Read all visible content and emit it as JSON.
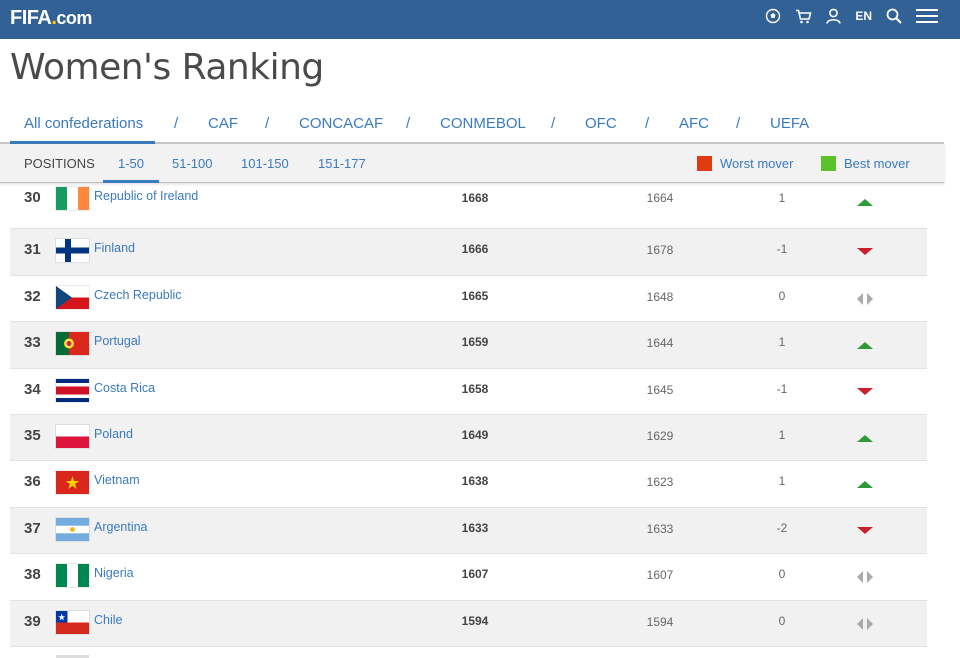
{
  "header": {
    "logo_main": "FIFA",
    "logo_suffix": "com",
    "language": "EN",
    "icons": [
      "ball-icon",
      "cart-icon",
      "user-icon",
      "search-icon",
      "menu-icon"
    ]
  },
  "page_title": "Women's Ranking",
  "confederations": [
    {
      "label": "All confederations",
      "active": true
    },
    {
      "label": "CAF"
    },
    {
      "label": "CONCACAF"
    },
    {
      "label": "CONMEBOL"
    },
    {
      "label": "OFC"
    },
    {
      "label": "AFC"
    },
    {
      "label": "UEFA"
    }
  ],
  "separator": "/",
  "position_tabs": {
    "label": "POSITIONS",
    "tabs": [
      {
        "label": "1-50",
        "active": true
      },
      {
        "label": "51-100"
      },
      {
        "label": "101-150"
      },
      {
        "label": "151-177"
      }
    ]
  },
  "legend": {
    "worst": {
      "label": "Worst mover",
      "color": "#e23b0f"
    },
    "best": {
      "label": "Best mover",
      "color": "#5cc22a"
    }
  },
  "colors": {
    "up": "#2e9a3a",
    "down": "#c8202c",
    "same": "#aaaaaa",
    "link": "#3a7abf",
    "header": "#326295"
  },
  "rows": [
    {
      "rank": "30",
      "flag": "ireland",
      "country": "Republic of Ireland",
      "points": "1668",
      "previous": "1664",
      "movement": "1",
      "trend": "up"
    },
    {
      "rank": "31",
      "flag": "finland",
      "country": "Finland",
      "points": "1666",
      "previous": "1678",
      "movement": "-1",
      "trend": "down"
    },
    {
      "rank": "32",
      "flag": "czech",
      "country": "Czech Republic",
      "points": "1665",
      "previous": "1648",
      "movement": "0",
      "trend": "same"
    },
    {
      "rank": "33",
      "flag": "portugal",
      "country": "Portugal",
      "points": "1659",
      "previous": "1644",
      "movement": "1",
      "trend": "up"
    },
    {
      "rank": "34",
      "flag": "costarica",
      "country": "Costa Rica",
      "points": "1658",
      "previous": "1645",
      "movement": "-1",
      "trend": "down"
    },
    {
      "rank": "35",
      "flag": "poland",
      "country": "Poland",
      "points": "1649",
      "previous": "1629",
      "movement": "1",
      "trend": "up"
    },
    {
      "rank": "36",
      "flag": "vietnam",
      "country": "Vietnam",
      "points": "1638",
      "previous": "1623",
      "movement": "1",
      "trend": "up"
    },
    {
      "rank": "37",
      "flag": "argentina",
      "country": "Argentina",
      "points": "1633",
      "previous": "1633",
      "movement": "-2",
      "trend": "down"
    },
    {
      "rank": "38",
      "flag": "nigeria",
      "country": "Nigeria",
      "points": "1607",
      "previous": "1607",
      "movement": "0",
      "trend": "same"
    },
    {
      "rank": "39",
      "flag": "chile",
      "country": "Chile",
      "points": "1594",
      "previous": "1594",
      "movement": "0",
      "trend": "same"
    }
  ]
}
